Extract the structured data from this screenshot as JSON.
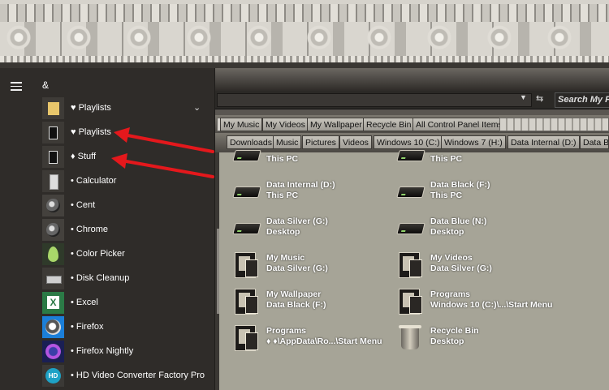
{
  "start_menu": {
    "letter_header": "&",
    "items": [
      {
        "label": "♥ Playlists",
        "icon": "folder-icon",
        "expanded": true
      },
      {
        "label": "♥ Playlists",
        "icon": "frame-icon"
      },
      {
        "label": "♦ Stuff",
        "icon": "frame-icon"
      },
      {
        "label": "• Calculator",
        "icon": "calculator-icon"
      },
      {
        "label": "• Cent",
        "icon": "cent-browser-icon"
      },
      {
        "label": "• Chrome",
        "icon": "chrome-icon"
      },
      {
        "label": "• Color Picker",
        "icon": "color-picker-icon"
      },
      {
        "label": "• Disk Cleanup",
        "icon": "disk-cleanup-icon"
      },
      {
        "label": "• Excel",
        "icon": "excel-icon"
      },
      {
        "label": "• Firefox",
        "icon": "firefox-icon"
      },
      {
        "label": "• Firefox Nightly",
        "icon": "firefox-nightly-icon"
      },
      {
        "label": "• HD Video Converter Factory Pro",
        "icon": "hd-converter-icon"
      }
    ]
  },
  "explorer": {
    "search_placeholder": "Search My Fo",
    "toolbar1": [
      "My Music",
      "My Videos",
      "My Wallpaper",
      "Recycle Bin",
      "All Control Panel Items"
    ],
    "toolbar2": [
      "Downloads",
      "Music",
      "Pictures",
      "Videos",
      "Windows 10 (C:)",
      "Windows 7 (H:)",
      "Data Internal (D:)",
      "Data B"
    ],
    "items": [
      {
        "name": "",
        "sub": "This PC",
        "icon": "drive-icon"
      },
      {
        "name": "",
        "sub": "This PC",
        "icon": "drive-icon"
      },
      {
        "name": "Data Internal (D:)",
        "sub": "This PC",
        "icon": "drive-icon"
      },
      {
        "name": "Data Black (F:)",
        "sub": "This PC",
        "icon": "drive-icon"
      },
      {
        "name": "Data Silver (G:)",
        "sub": "Desktop",
        "icon": "drive-icon"
      },
      {
        "name": "Data Blue (N:)",
        "sub": "Desktop",
        "icon": "drive-icon"
      },
      {
        "name": "My Music",
        "sub": "Data Silver (G:)",
        "icon": "folder-icon"
      },
      {
        "name": "My Videos",
        "sub": "Data Silver (G:)",
        "icon": "folder-icon"
      },
      {
        "name": "My Wallpaper",
        "sub": "Data Black (F:)",
        "icon": "folder-icon"
      },
      {
        "name": "Programs",
        "sub": "Windows 10 (C:)\\...\\Start Menu",
        "icon": "folder-icon"
      },
      {
        "name": "Programs",
        "sub": "♦ ♦\\AppData\\Ro...\\Start Menu",
        "icon": "folder-icon"
      },
      {
        "name": "Recycle Bin",
        "sub": "Desktop",
        "icon": "recycle-bin-icon"
      }
    ]
  },
  "colors": {
    "annotation_arrow": "#e4181c",
    "start_bg": "#2f2c29",
    "content_bg": "#a6a497"
  }
}
